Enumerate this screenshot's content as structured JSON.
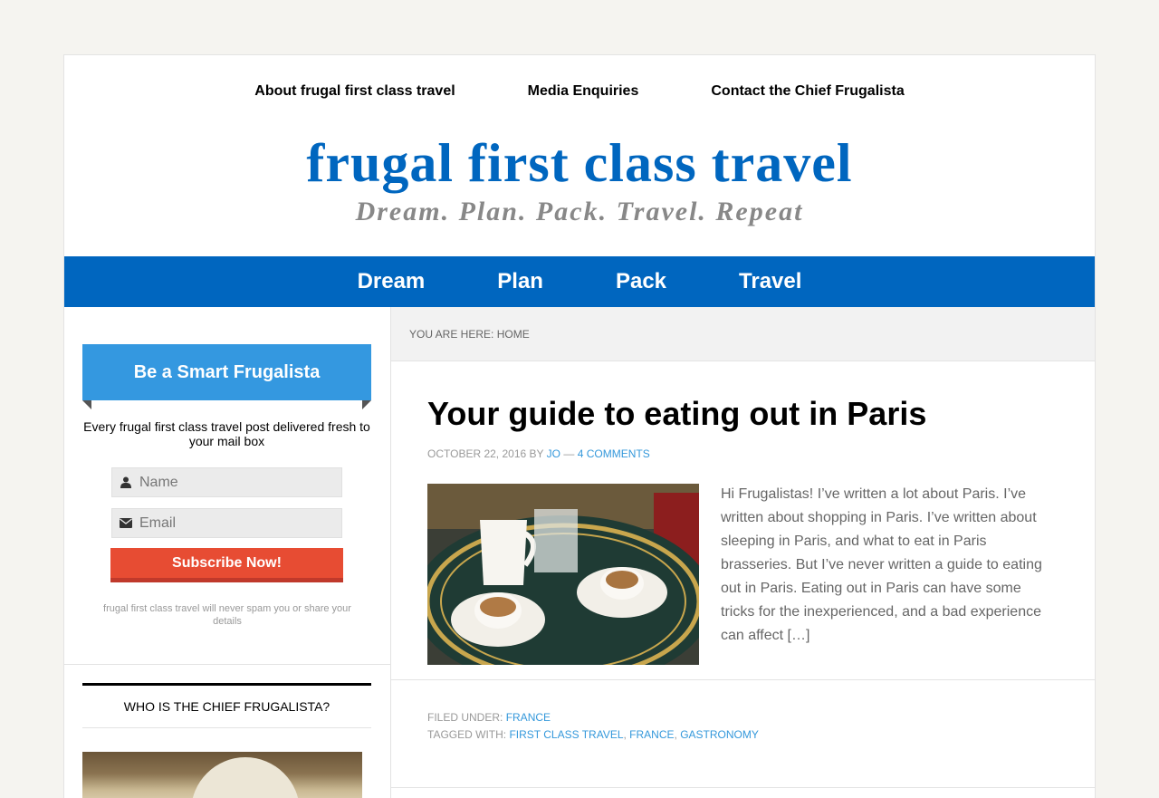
{
  "top_nav": [
    {
      "label": "About frugal first class travel"
    },
    {
      "label": "Media Enquiries"
    },
    {
      "label": "Contact the Chief Frugalista"
    }
  ],
  "site": {
    "title": "frugal first class travel",
    "description": "Dream. Plan. Pack. Travel. Repeat",
    "brand_color": "#0066bf"
  },
  "primary_nav": [
    {
      "label": "Dream"
    },
    {
      "label": "Plan"
    },
    {
      "label": "Pack"
    },
    {
      "label": "Travel"
    }
  ],
  "optin": {
    "title": "Be a Smart Frugalista",
    "text": "Every frugal first class travel post delivered fresh to your mail box",
    "name_placeholder": "Name",
    "email_placeholder": "Email",
    "button_label": "Subscribe Now!",
    "note": "frugal first class travel will never spam you or share your details",
    "ribbon_color": "#3498e0",
    "button_color": "#e74c33"
  },
  "widget": {
    "title": "WHO IS THE CHIEF FRUGALISTA?"
  },
  "breadcrumb": {
    "prefix": "YOU ARE HERE:",
    "current": "HOME"
  },
  "post": {
    "title": "Your guide to eating out in Paris",
    "date": "OCTOBER 22, 2016",
    "by": "BY",
    "author": "JO",
    "separator": "—",
    "comments": "4 COMMENTS",
    "excerpt": "Hi Frugalistas!  I’ve written a lot about Paris.  I’ve written about shopping in Paris.  I’ve written about sleeping in Paris, and what to eat in Paris brasseries.  But I’ve never written a guide to eating out in Paris.  Eating out in Paris can have some tricks for the inexperienced, and a bad experience can affect […]",
    "filed_label": "FILED UNDER:",
    "filed": [
      "FRANCE"
    ],
    "tagged_label": "TAGGED WITH:",
    "tags": [
      "FIRST CLASS TRAVEL",
      "FRANCE",
      "GASTRONOMY"
    ],
    "link_color": "#3498db"
  }
}
